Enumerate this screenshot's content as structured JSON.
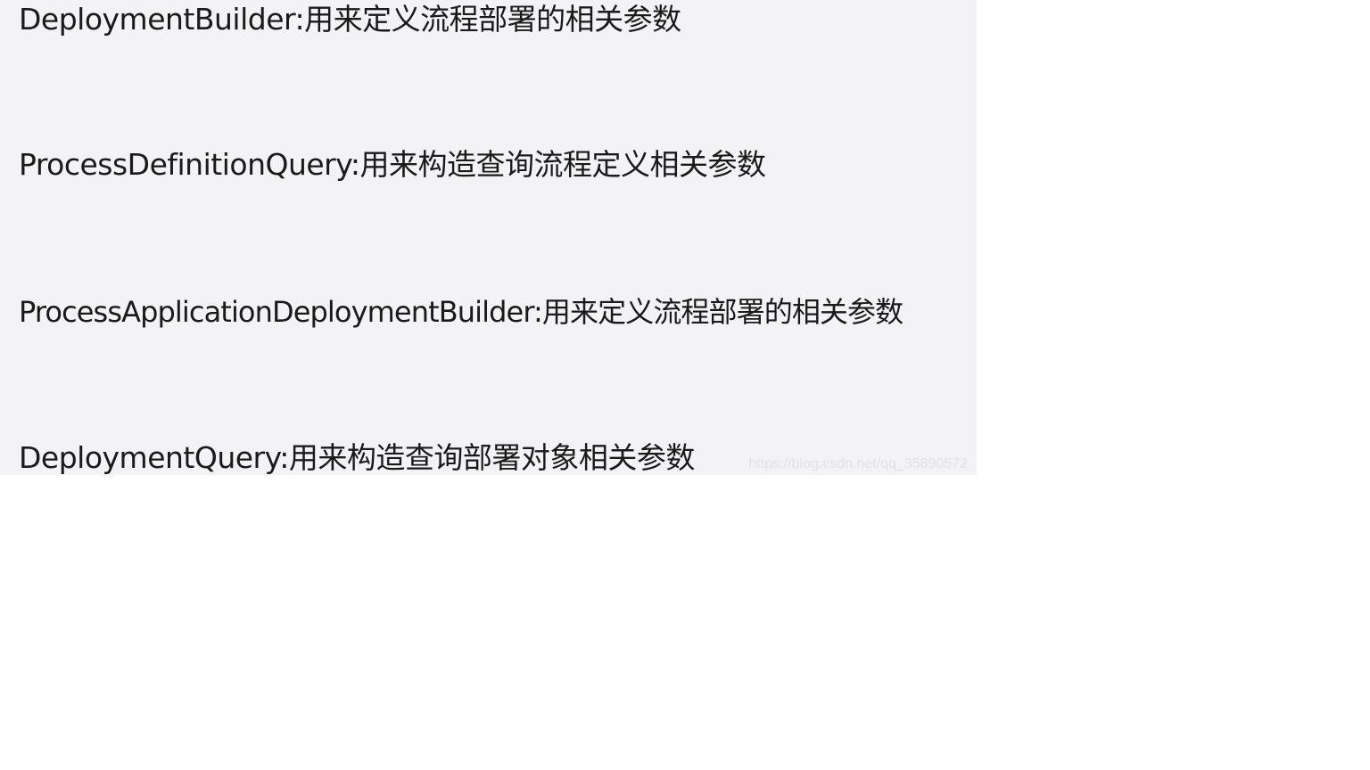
{
  "lines": [
    "DeploymentBuilder:用来定义流程部署的相关参数",
    "ProcessDefinitionQuery:用来构造查询流程定义相关参数",
    "ProcessApplicationDeploymentBuilder:用来定义流程部署的相关参数",
    "DeploymentQuery:用来构造查询部署对象相关参数"
  ],
  "watermark": "https://blog.csdn.net/qq_35890572",
  "colors": {
    "panel_background": "#f3f3f5",
    "page_background": "#ffffff",
    "text": "#1a1a1a"
  }
}
